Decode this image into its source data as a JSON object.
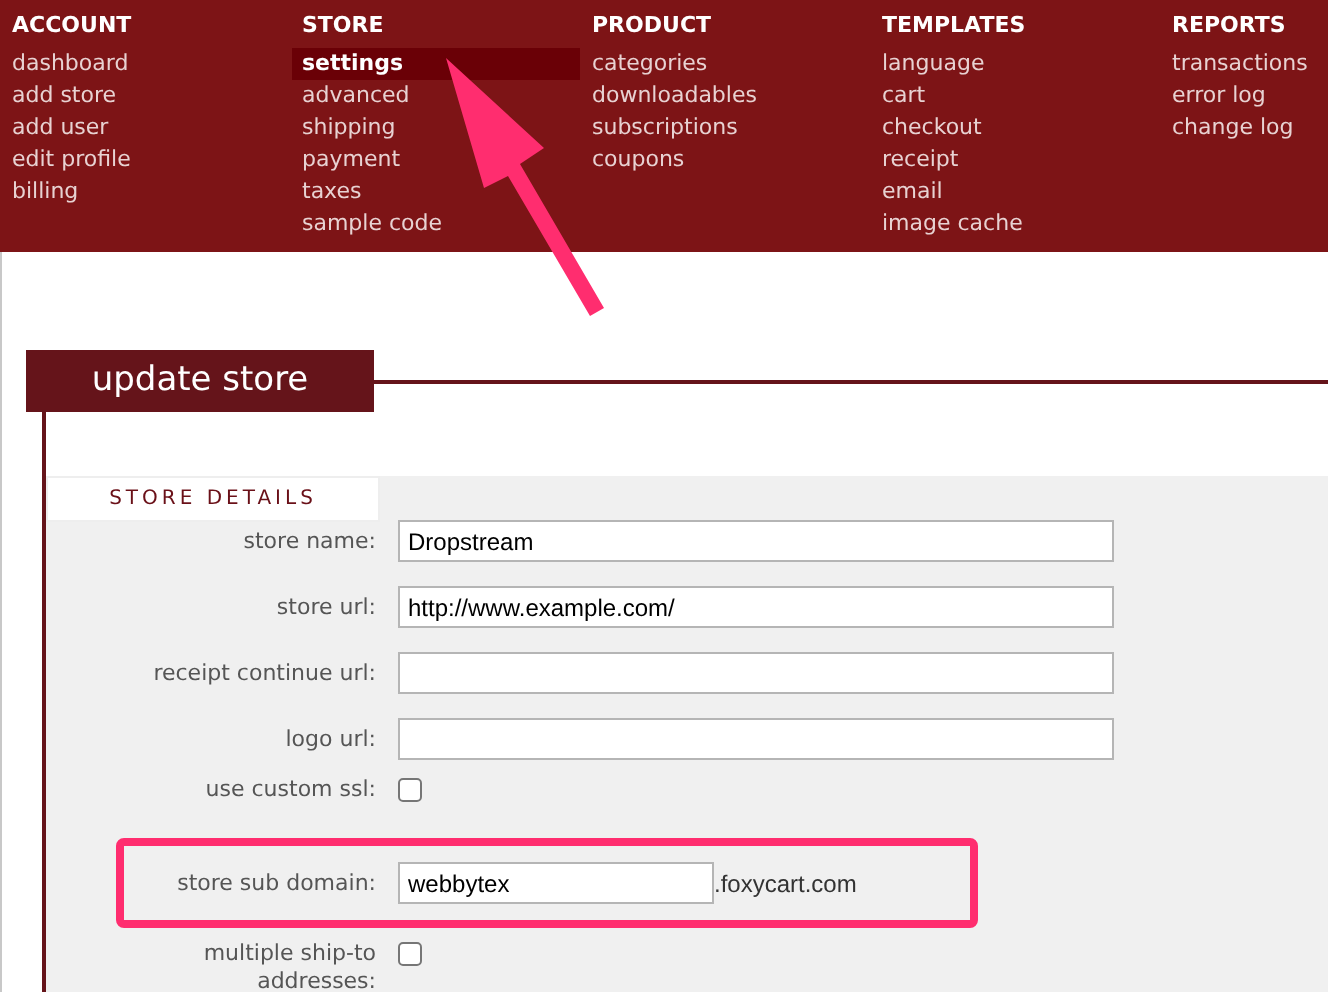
{
  "nav": [
    {
      "heading": "ACCOUNT",
      "items": [
        {
          "label": "dashboard",
          "selected": false
        },
        {
          "label": "add store",
          "selected": false
        },
        {
          "label": "add user",
          "selected": false
        },
        {
          "label": "edit profile",
          "selected": false
        },
        {
          "label": "billing",
          "selected": false
        }
      ]
    },
    {
      "heading": "STORE",
      "items": [
        {
          "label": "settings",
          "selected": true
        },
        {
          "label": "advanced",
          "selected": false
        },
        {
          "label": "shipping",
          "selected": false
        },
        {
          "label": "payment",
          "selected": false
        },
        {
          "label": "taxes",
          "selected": false
        },
        {
          "label": "sample code",
          "selected": false
        }
      ]
    },
    {
      "heading": "PRODUCT",
      "items": [
        {
          "label": "categories",
          "selected": false
        },
        {
          "label": "downloadables",
          "selected": false
        },
        {
          "label": "subscriptions",
          "selected": false
        },
        {
          "label": "coupons",
          "selected": false
        }
      ]
    },
    {
      "heading": "TEMPLATES",
      "items": [
        {
          "label": "language",
          "selected": false
        },
        {
          "label": "cart",
          "selected": false
        },
        {
          "label": "checkout",
          "selected": false
        },
        {
          "label": "receipt",
          "selected": false
        },
        {
          "label": "email",
          "selected": false
        },
        {
          "label": "image cache",
          "selected": false
        }
      ]
    },
    {
      "heading": "REPORTS",
      "items": [
        {
          "label": "transactions",
          "selected": false
        },
        {
          "label": "error log",
          "selected": false
        },
        {
          "label": "change log",
          "selected": false
        }
      ]
    }
  ],
  "section": {
    "title": "update store",
    "tab": "STORE DETAILS"
  },
  "fields": [
    {
      "kind": "text",
      "label": "store name:",
      "value": "Dropstream"
    },
    {
      "kind": "text",
      "label": "store url:",
      "value": "http://www.example.com/"
    },
    {
      "kind": "text",
      "label": "receipt continue url:"
    },
    {
      "kind": "text",
      "label": "logo url:"
    },
    {
      "kind": "checkbox",
      "label": "use custom ssl:",
      "checked": false
    },
    {
      "kind": "subdomain",
      "label": "store sub domain:",
      "value": "webbytex",
      "suffix": ".foxycart.com",
      "highlighted": true
    },
    {
      "kind": "checkbox",
      "label": "multiple ship-to addresses:",
      "checked": false
    }
  ]
}
